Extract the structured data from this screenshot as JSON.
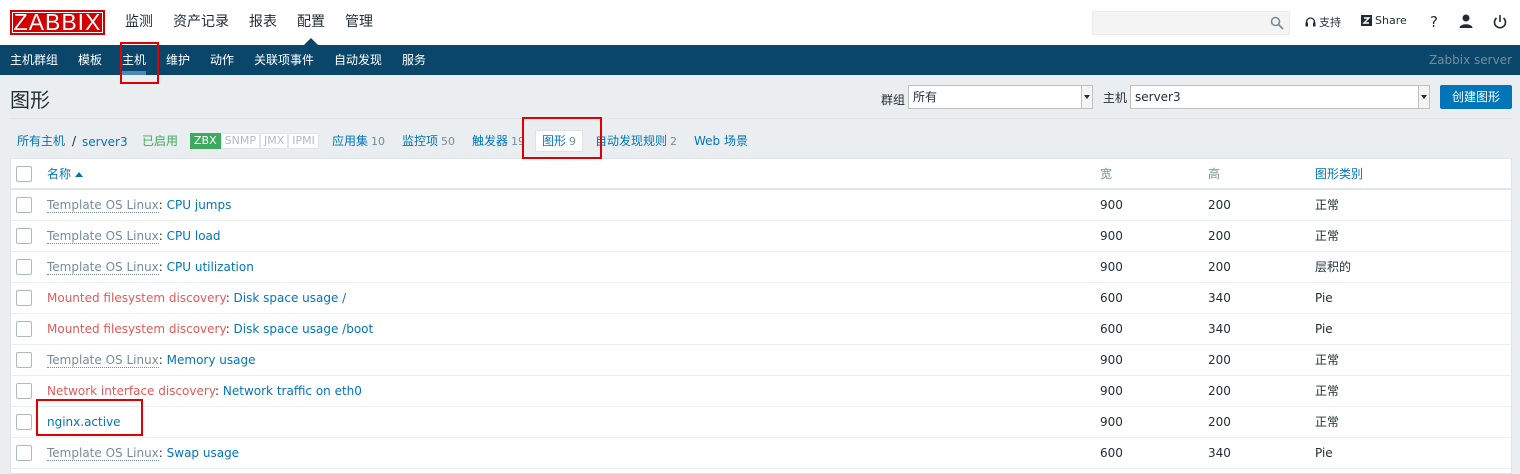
{
  "header": {
    "logo_text": "ZABBIX",
    "main_menu": [
      {
        "label": "监测"
      },
      {
        "label": "资产记录"
      },
      {
        "label": "报表"
      },
      {
        "label": "配置"
      },
      {
        "label": "管理"
      }
    ],
    "support_label": "支持",
    "share_label": "Share",
    "help_label": "?"
  },
  "submenu": {
    "items": [
      {
        "label": "主机群组"
      },
      {
        "label": "模板"
      },
      {
        "label": "主机"
      },
      {
        "label": "维护"
      },
      {
        "label": "动作"
      },
      {
        "label": "关联项事件"
      },
      {
        "label": "自动发现"
      },
      {
        "label": "服务"
      }
    ],
    "server_label": "Zabbix server"
  },
  "page": {
    "title": "图形",
    "filter_group_label": "群组",
    "filter_group_value": "所有",
    "filter_host_label": "主机",
    "filter_host_value": "server3",
    "create_button": "创建图形"
  },
  "breadcrumb": {
    "all_hosts": "所有主机",
    "separator": "/",
    "host": "server3",
    "status": "已启用",
    "badges": [
      "ZBX",
      "SNMP",
      "JMX",
      "IPMI"
    ]
  },
  "tabs": [
    {
      "label": "应用集",
      "count": "10"
    },
    {
      "label": "监控项",
      "count": "50"
    },
    {
      "label": "触发器",
      "count": "19"
    },
    {
      "label": "图形",
      "count": "9"
    },
    {
      "label": "自动发现规则",
      "count": "2"
    },
    {
      "label": "Web 场景",
      "count": ""
    }
  ],
  "table": {
    "headers": {
      "name": "名称",
      "width": "宽",
      "height": "高",
      "type": "图形类别"
    },
    "rows": [
      {
        "prefix": "Template OS Linux",
        "prefix_kind": "template",
        "sep": ": ",
        "name": "CPU jumps",
        "width": "900",
        "height": "200",
        "type": "正常"
      },
      {
        "prefix": "Template OS Linux",
        "prefix_kind": "template",
        "sep": ": ",
        "name": "CPU load",
        "width": "900",
        "height": "200",
        "type": "正常"
      },
      {
        "prefix": "Template OS Linux",
        "prefix_kind": "template",
        "sep": ": ",
        "name": "CPU utilization",
        "width": "900",
        "height": "200",
        "type": "层积的"
      },
      {
        "prefix": "Mounted filesystem discovery",
        "prefix_kind": "discovery",
        "sep": ": ",
        "name": "Disk space usage /",
        "width": "600",
        "height": "340",
        "type": "Pie"
      },
      {
        "prefix": "Mounted filesystem discovery",
        "prefix_kind": "discovery",
        "sep": ": ",
        "name": "Disk space usage /boot",
        "width": "600",
        "height": "340",
        "type": "Pie"
      },
      {
        "prefix": "Template OS Linux",
        "prefix_kind": "template",
        "sep": ": ",
        "name": "Memory usage",
        "width": "900",
        "height": "200",
        "type": "正常"
      },
      {
        "prefix": "Network interface discovery",
        "prefix_kind": "discovery",
        "sep": ": ",
        "name": "Network traffic on eth0",
        "width": "900",
        "height": "200",
        "type": "正常"
      },
      {
        "prefix": "",
        "prefix_kind": "none",
        "sep": "",
        "name": "nginx.active",
        "width": "900",
        "height": "200",
        "type": "正常"
      },
      {
        "prefix": "Template OS Linux",
        "prefix_kind": "template",
        "sep": ": ",
        "name": "Swap usage",
        "width": "600",
        "height": "340",
        "type": "Pie"
      }
    ]
  },
  "colors": {
    "brand_red": "#d40000",
    "nav_blue": "#0a466a",
    "link_blue": "#0275b8",
    "enabled_green": "#3daa5f",
    "discovery_orange": "#e45959",
    "annotation_red": "#e00000"
  }
}
